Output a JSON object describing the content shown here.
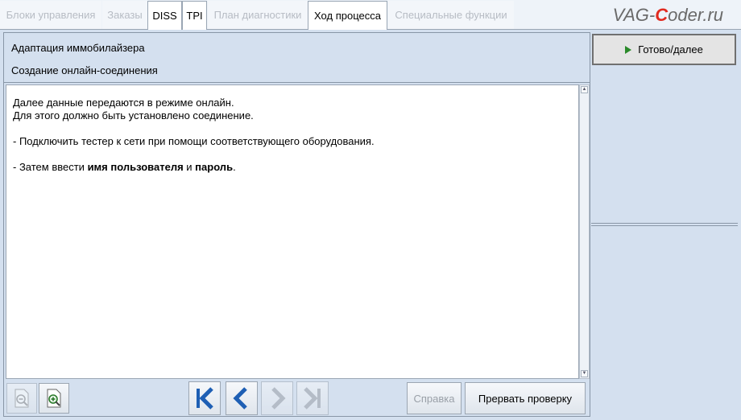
{
  "tabs": [
    {
      "label": "Блоки управления",
      "active": false
    },
    {
      "label": "Заказы",
      "active": false
    },
    {
      "label": "DISS",
      "active": true
    },
    {
      "label": "TPI",
      "active": true
    },
    {
      "label": "План диагностики",
      "active": false
    },
    {
      "label": "Ход процесса",
      "active": true
    },
    {
      "label": "Специальные функции",
      "active": false
    }
  ],
  "logo": {
    "pre": "VAG-",
    "c": "C",
    "post": "oder.ru"
  },
  "header": {
    "title": "Адаптация иммобилайзера",
    "subtitle": "Создание онлайн-соединения"
  },
  "content": {
    "line1": "Далее данные передаются в режиме онлайн.",
    "line2": "Для этого должно быть установлено соединение.",
    "line3": "- Подключить тестер к сети при помощи соответствующего оборудования.",
    "line4_a": "- Затем ввести ",
    "line4_b": "имя пользователя",
    "line4_c": " и ",
    "line4_d": "пароль",
    "line4_e": "."
  },
  "toolbar": {
    "help_label": "Справка",
    "abort_label": "Прервать проверку"
  },
  "side": {
    "next_label": "Готово/далее"
  },
  "colors": {
    "background": "#d4e0ef",
    "nav_blue": "#1e5fb4",
    "next_green": "#2a8a2a",
    "logo_red": "#e12a1f"
  },
  "icons": [
    "zoom-out-icon",
    "zoom-in-icon",
    "first-page-icon",
    "previous-icon",
    "next-icon",
    "last-page-icon",
    "play-icon"
  ]
}
